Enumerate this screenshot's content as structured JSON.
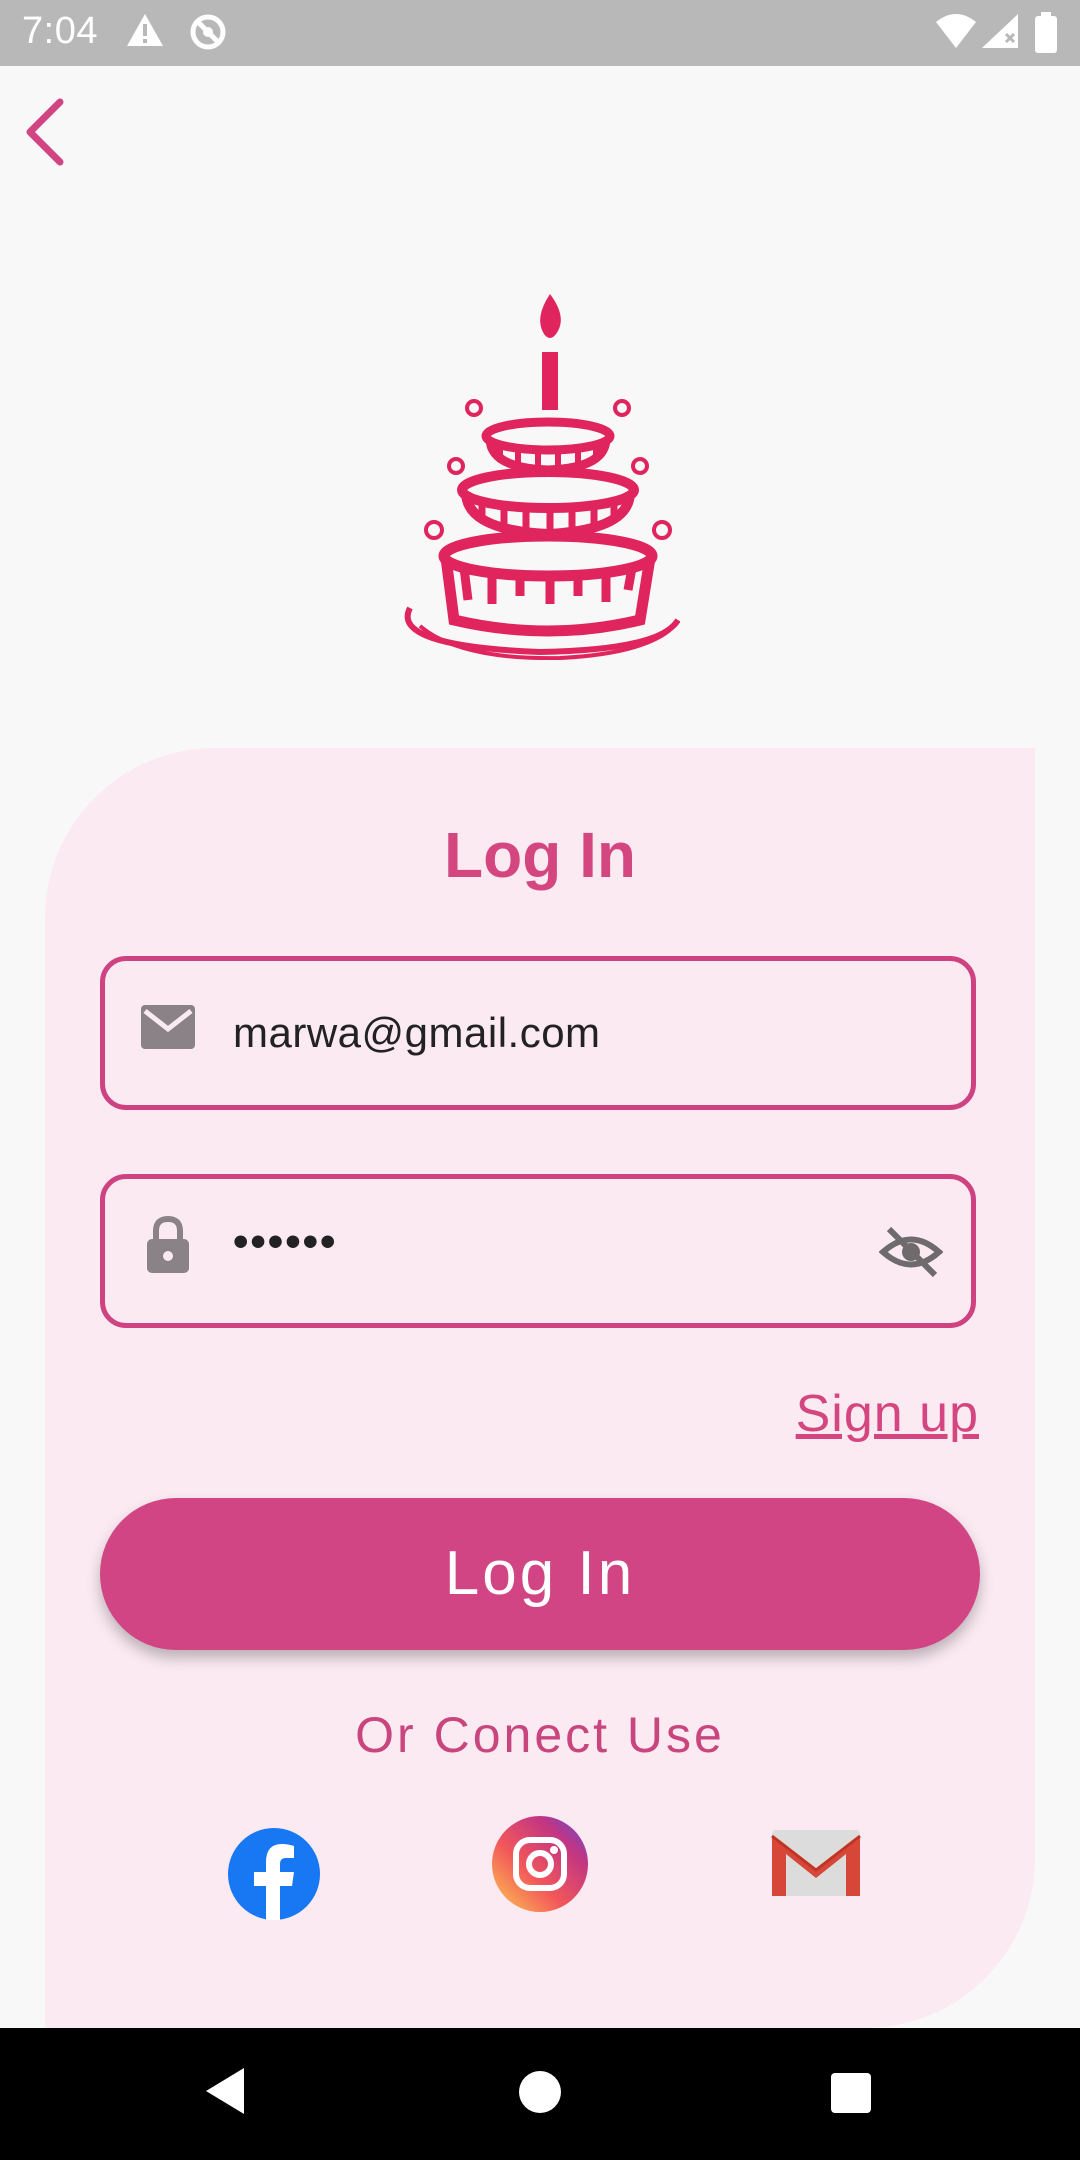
{
  "status_bar": {
    "time": "7:04",
    "icons": [
      "warning-icon",
      "sync-icon",
      "wifi-icon",
      "signal-icon",
      "battery-icon"
    ]
  },
  "header": {
    "back_icon": "chevron-left-icon"
  },
  "logo": {
    "icon": "birthday-cake-icon"
  },
  "login_card": {
    "title": "Log In",
    "email": {
      "value": "marwa@gmail.com",
      "icon": "mail-icon"
    },
    "password": {
      "value": "••••••",
      "icon": "lock-icon",
      "toggle_icon": "eye-off-icon"
    },
    "signup_label": "Sign up",
    "login_button_label": "Log In",
    "or_text": "Or Conect Use",
    "social": [
      "facebook-icon",
      "instagram-icon",
      "gmail-icon"
    ]
  },
  "nav_bar": {
    "buttons": [
      "back-icon",
      "home-icon",
      "recents-icon"
    ]
  },
  "colors": {
    "accent": "#d14584",
    "card_bg": "#fbeaf2",
    "status_bar": "#b8b8b8",
    "cake": "#e0245e"
  }
}
